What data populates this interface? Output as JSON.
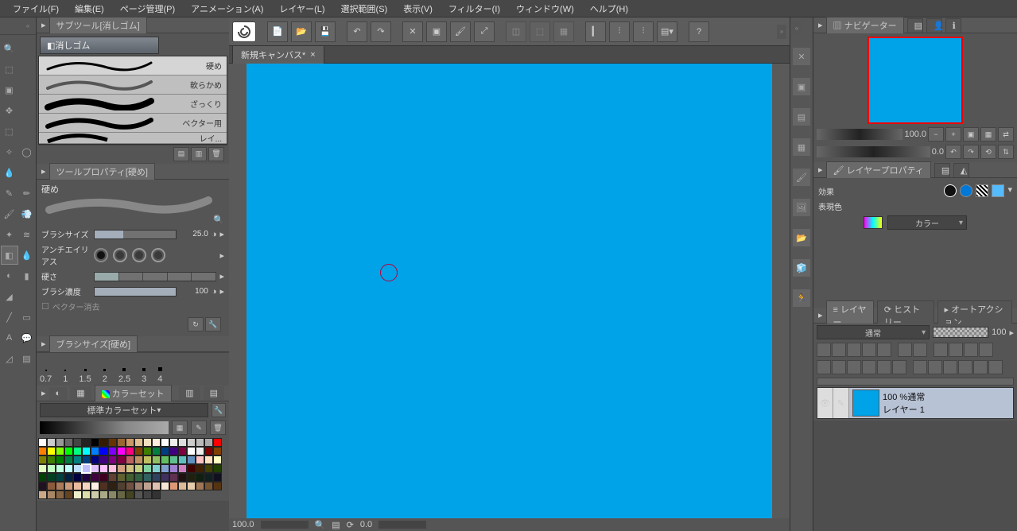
{
  "menu": [
    "ファイル(F)",
    "編集(E)",
    "ページ管理(P)",
    "アニメーション(A)",
    "レイヤー(L)",
    "選択範囲(S)",
    "表示(V)",
    "フィルター(I)",
    "ウィンドウ(W)",
    "ヘルプ(H)"
  ],
  "tab": {
    "title": "新規キャンバス*"
  },
  "subtool": {
    "panel_title": "サブツール[消しゴム]",
    "selected": "消しゴム",
    "items": [
      "硬め",
      "軟らかめ",
      "ざっくり",
      "ベクター用",
      "レイ..."
    ]
  },
  "toolprop": {
    "panel_title": "ツールプロパティ[硬め]",
    "title": "硬め",
    "rows": {
      "brush_size_label": "ブラシサイズ",
      "brush_size_value": "25.0",
      "aa_label": "アンチエイリアス",
      "hardness_label": "硬さ",
      "density_label": "ブラシ濃度",
      "density_value": "100",
      "vector_erase_label": "ベクター消去"
    }
  },
  "brushsize_panel": {
    "title": "ブラシサイズ[硬め]",
    "sizes": [
      "0.7",
      "1",
      "1.5",
      "2",
      "2.5",
      "3",
      "4"
    ]
  },
  "colorset": {
    "title": "カラーセット",
    "set_name": "標準カラーセット",
    "rows": [
      [
        "#ffffff",
        "#cccccc",
        "#999999",
        "#666666",
        "#444444",
        "#222222",
        "#000000",
        "#331a00",
        "#663300",
        "#996633",
        "#cc9966",
        "#e0c090",
        "#f0e0c0",
        "#ffeedd",
        "#fff",
        "#eee",
        "#ddd",
        "#ccc",
        "#bbb",
        "#aaa"
      ],
      [
        "#ff0000",
        "#ff7f00",
        "#ffff00",
        "#7fff00",
        "#00ff00",
        "#00ff7f",
        "#00ffff",
        "#007fff",
        "#0000ff",
        "#7f00ff",
        "#ff00ff",
        "#ff007f",
        "#7f3f00",
        "#3f7f00",
        "#007f3f",
        "#003f7f",
        "#3f007f",
        "#7f003f",
        "#fff",
        "#eee"
      ],
      [
        "#800000",
        "#804000",
        "#808000",
        "#408000",
        "#008000",
        "#008040",
        "#008080",
        "#004080",
        "#000080",
        "#400080",
        "#800080",
        "#800040",
        "#bf6060",
        "#bf9060",
        "#bfbf60",
        "#90bf60",
        "#60bf60",
        "#60bf90",
        "#60bfbf",
        "#6090bf"
      ],
      [
        "#ffc0c0",
        "#ffe0c0",
        "#ffffc0",
        "#e0ffc0",
        "#c0ffc0",
        "#c0ffe0",
        "#c0ffff",
        "#c0e0ff",
        "#c0c0ff",
        "#e0c0ff",
        "#ffc0ff",
        "#ffc0e0",
        "#d0a080",
        "#d0c080",
        "#c0d080",
        "#80d0a0",
        "#80d0d0",
        "#80a0d0",
        "#a080d0",
        "#d080c0"
      ],
      [
        "#400000",
        "#402000",
        "#404000",
        "#204000",
        "#004000",
        "#004020",
        "#004040",
        "#002040",
        "#000040",
        "#200040",
        "#400040",
        "#400020",
        "#604030",
        "#606030",
        "#406030",
        "#306040",
        "#306060",
        "#304060",
        "#403060",
        "#603050"
      ],
      [
        "#201010",
        "#202010",
        "#102010",
        "#102020",
        "#101020",
        "#201020",
        "#8a5a3a",
        "#aa7a5a",
        "#ca9a7a",
        "#eabaa0",
        "#f5d5c0",
        "#fff0e5",
        "#503020",
        "#302010",
        "#504030",
        "#705040",
        "#a08070",
        "#c0a090",
        "#e0c0b0",
        "#f5e5d5"
      ],
      [
        "#dd9977",
        "#ddbb99",
        "#e5ccaa",
        "#9f7755",
        "#775533",
        "#553311",
        "#cba987",
        "#a98765",
        "#876543",
        "#654321",
        "#eeeecc",
        "#ddddaa",
        "#ccccaa",
        "#aaaa88",
        "#888866",
        "#666644",
        "#444422",
        "#555",
        "#444",
        "#333"
      ]
    ],
    "selected": [
      3,
      8
    ]
  },
  "navigator": {
    "title": "ナビゲーター",
    "zoom_value": "100.0",
    "angle_value": "0.0"
  },
  "layerprop": {
    "title": "レイヤープロパティ",
    "effect_label": "効果",
    "expr_label": "表現色",
    "color_mode": "カラー"
  },
  "layers": {
    "title": "レイヤー",
    "history_tab": "ヒストリー",
    "action_tab": "オートアクション",
    "blend_mode": "通常",
    "opacity": "100",
    "item": {
      "opacity_text": "100 %通常",
      "name": "レイヤー 1"
    }
  },
  "status": {
    "zoom": "100.0",
    "angle": "0.0"
  }
}
